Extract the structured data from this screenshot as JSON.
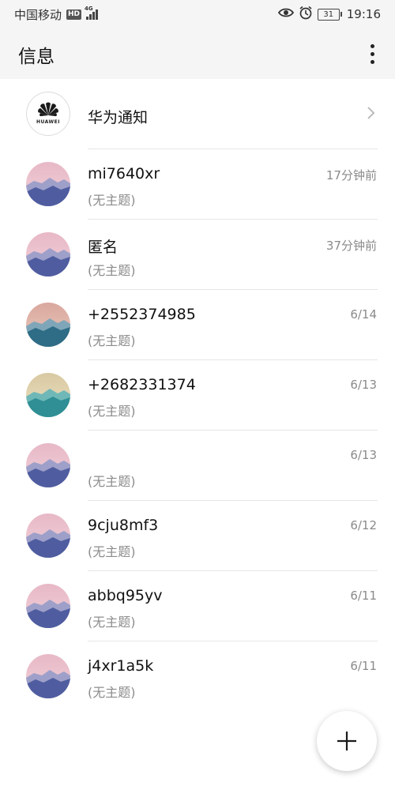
{
  "status_bar": {
    "carrier": "中国移动",
    "hd_badge": "HD",
    "network": "4G",
    "battery_level": "31",
    "time": "19:16"
  },
  "header": {
    "title": "信息"
  },
  "notice": {
    "title": "华为通知",
    "logo_text": "HUAWEI"
  },
  "conversations": [
    {
      "name": "mi7640xr",
      "subject": "(无主题)",
      "time": "17分钟前",
      "avatar": "purple"
    },
    {
      "name": "匿名",
      "subject": "(无主题)",
      "time": "37分钟前",
      "avatar": "purple"
    },
    {
      "name": "+2552374985",
      "subject": "(无主题)",
      "time": "6/14",
      "avatar": "teal-peach"
    },
    {
      "name": "+2682331374",
      "subject": "(无主题)",
      "time": "6/13",
      "avatar": "teal-cream"
    },
    {
      "name": "",
      "subject": "(无主题)",
      "time": "6/13",
      "avatar": "purple"
    },
    {
      "name": "9cju8mf3",
      "subject": "(无主题)",
      "time": "6/12",
      "avatar": "purple"
    },
    {
      "name": "abbq95yv",
      "subject": "(无主题)",
      "time": "6/11",
      "avatar": "purple"
    },
    {
      "name": "j4xr1a5k",
      "subject": "(无主题)",
      "time": "6/11",
      "avatar": "purple"
    }
  ],
  "icons": {
    "menu": "more-vertical-icon",
    "new_message": "plus-icon",
    "chevron": "chevron-right-icon",
    "eye": "eye-icon",
    "alarm": "alarm-icon"
  }
}
